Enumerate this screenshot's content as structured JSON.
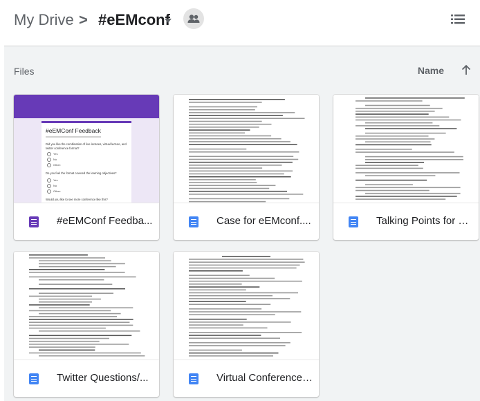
{
  "header": {
    "root": "My Drive",
    "separator": ">",
    "current_folder": "#eEMconf"
  },
  "main": {
    "section_label": "Files",
    "sort_label": "Name"
  },
  "files": [
    {
      "name": "#eEMConf Feedba...",
      "type": "form",
      "thumb": {
        "title": "#eEMConf Feedback",
        "q1": "Did you like the combination of live lectures, virtual lecture, and twitter conference format?",
        "options": [
          "Yes",
          "No",
          "Other:"
        ],
        "q2": "Do you feel the format covered the learning objectives?",
        "options2": [
          "Yes",
          "No",
          "Other:"
        ],
        "q3": "Would you like to see more conference like this?"
      }
    },
    {
      "name": "Case for eEMconf....",
      "type": "doc"
    },
    {
      "name": "Talking Points for E...",
      "type": "doc"
    },
    {
      "name": "Twitter Questions/...",
      "type": "doc"
    },
    {
      "name": "Virtual Conference ...",
      "type": "doc"
    }
  ],
  "colors": {
    "form_icon": "#673ab7",
    "doc_icon": "#4285f4",
    "main_bg": "#f1f3f4"
  }
}
